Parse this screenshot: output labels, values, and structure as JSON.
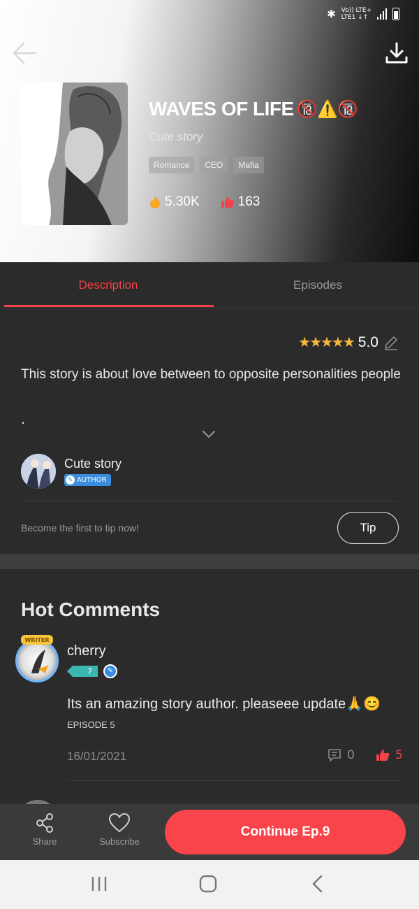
{
  "status": {
    "network_top": "Vo)) LTE+",
    "network_bottom": "LTE1 ↓↑"
  },
  "header": {
    "back_icon": "arrow-left-icon",
    "download_icon": "download-icon"
  },
  "book": {
    "title": "WAVES OF LIFE",
    "title_emojis": "🔞⚠️🔞",
    "subtitle": "Cute story",
    "tags": [
      "Romance",
      "CEO",
      "Mafia"
    ],
    "views": "5.30K",
    "likes": "163"
  },
  "tabs": [
    {
      "label": "Description",
      "active": true
    },
    {
      "label": "Episodes",
      "active": false
    }
  ],
  "description": {
    "rating_stars": "★★★★★",
    "rating": "5.0",
    "text": "This story is about love between to opposite personalities people",
    "trailing": ".",
    "author_name": "Cute story",
    "author_badge": "AUTHOR",
    "tip_prompt": "Become the first to tip now!",
    "tip_label": "Tip"
  },
  "comments": {
    "section_title": "Hot Comments",
    "items": [
      {
        "user": "cherry",
        "level": "7",
        "crest": "WRITER",
        "text": "Its an amazing story author. pleaseee update🙏😊",
        "episode": "EPISODE 5",
        "date": "16/01/2021",
        "replies": "0",
        "likes": "5"
      }
    ]
  },
  "bottom_bar": {
    "share_label": "Share",
    "subscribe_label": "Subscribe",
    "continue_label": "Continue Ep.9"
  },
  "colors": {
    "accent": "#f8444a",
    "star": "#f6b93b",
    "author_blue": "#3b8de0"
  }
}
